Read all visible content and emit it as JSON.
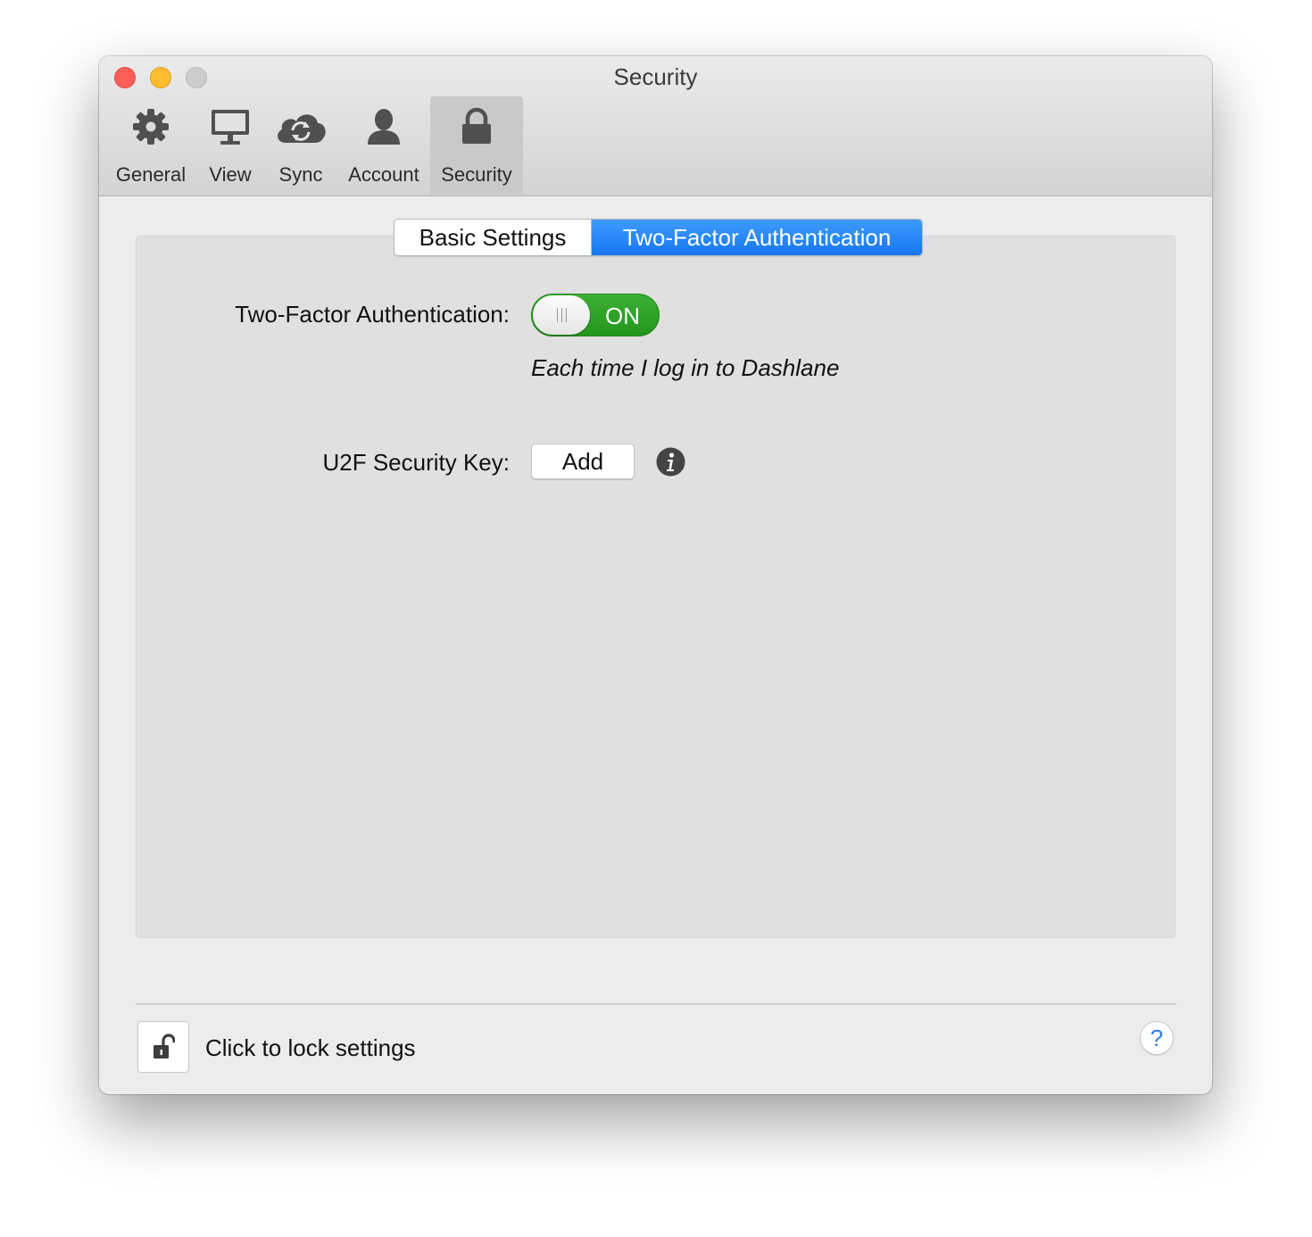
{
  "window": {
    "title": "Security"
  },
  "toolbar": {
    "items": [
      {
        "label": "General",
        "icon": "gear-icon"
      },
      {
        "label": "View",
        "icon": "monitor-icon"
      },
      {
        "label": "Sync",
        "icon": "cloud-sync-icon"
      },
      {
        "label": "Account",
        "icon": "person-icon"
      },
      {
        "label": "Security",
        "icon": "lock-icon",
        "selected": true
      }
    ]
  },
  "tabs": {
    "items": [
      {
        "label": "Basic Settings"
      },
      {
        "label": "Two-Factor Authentication",
        "active": true
      }
    ]
  },
  "two_factor": {
    "label": "Two-Factor Authentication:",
    "toggle_state": "ON",
    "description": "Each time I log in to Dashlane"
  },
  "u2f": {
    "label": "U2F Security Key:",
    "button_label": "Add",
    "info_icon": "info-icon"
  },
  "footer": {
    "lock_label": "Click to lock settings",
    "lock_icon": "unlocked-padlock-icon",
    "help_label": "?"
  },
  "colors": {
    "accent_blue": "#1677f1",
    "toggle_green": "#2ea227",
    "help_blue": "#2a7de1"
  }
}
